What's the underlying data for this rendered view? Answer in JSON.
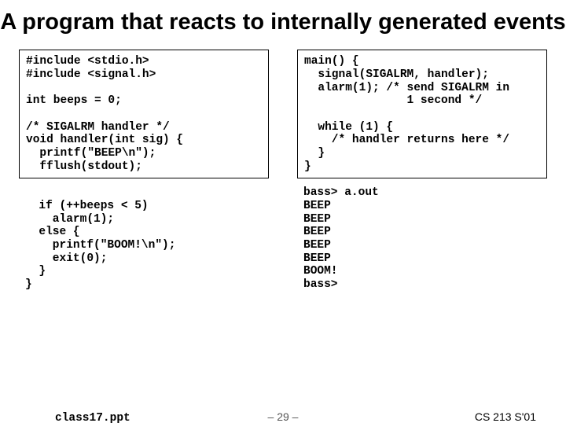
{
  "title": "A program that reacts to internally generated events",
  "left": {
    "box1": "#include <stdio.h>\n#include <signal.h>\n\nint beeps = 0;\n\n/* SIGALRM handler */\nvoid handler(int sig) {\n  printf(\"BEEP\\n\");\n  fflush(stdout);",
    "plain": "\n  if (++beeps < 5)\n    alarm(1);\n  else {\n    printf(\"BOOM!\\n\");\n    exit(0);\n  }\n}"
  },
  "right": {
    "box1": "main() {\n  signal(SIGALRM, handler);\n  alarm(1); /* send SIGALRM in\n               1 second */\n\n  while (1) {\n    /* handler returns here */\n  }\n}",
    "output": "bass> a.out\nBEEP\nBEEP\nBEEP\nBEEP\nBEEP\nBOOM!\nbass>"
  },
  "footer": {
    "file": "class17.ppt",
    "page": "– 29 –",
    "course": "CS 213 S'01"
  }
}
